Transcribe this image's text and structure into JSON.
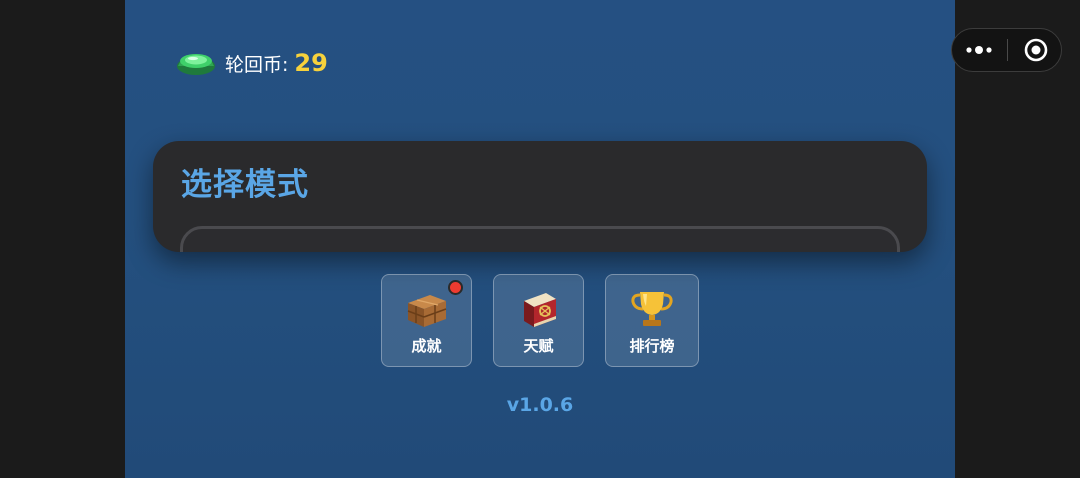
{
  "currency": {
    "icon": "bottle-cap-icon",
    "label": "轮回币:",
    "value": "29"
  },
  "mode_panel": {
    "title": "选择模式"
  },
  "buttons": [
    {
      "label": "成就",
      "icon": "treasure-chest-icon",
      "has_notification": true
    },
    {
      "label": "天赋",
      "icon": "spell-book-icon",
      "has_notification": false
    },
    {
      "label": "排行榜",
      "icon": "trophy-icon",
      "has_notification": false
    }
  ],
  "version": "v1.0.6",
  "capsule": {
    "more_icon": "more-dots-icon",
    "close_icon": "target-close-icon"
  },
  "colors": {
    "background": "#24507f",
    "accent_blue": "#5aa6e6",
    "coin_gold": "#f7d23c",
    "panel": "#2a2a2c",
    "badge_red": "#ee3b30"
  }
}
